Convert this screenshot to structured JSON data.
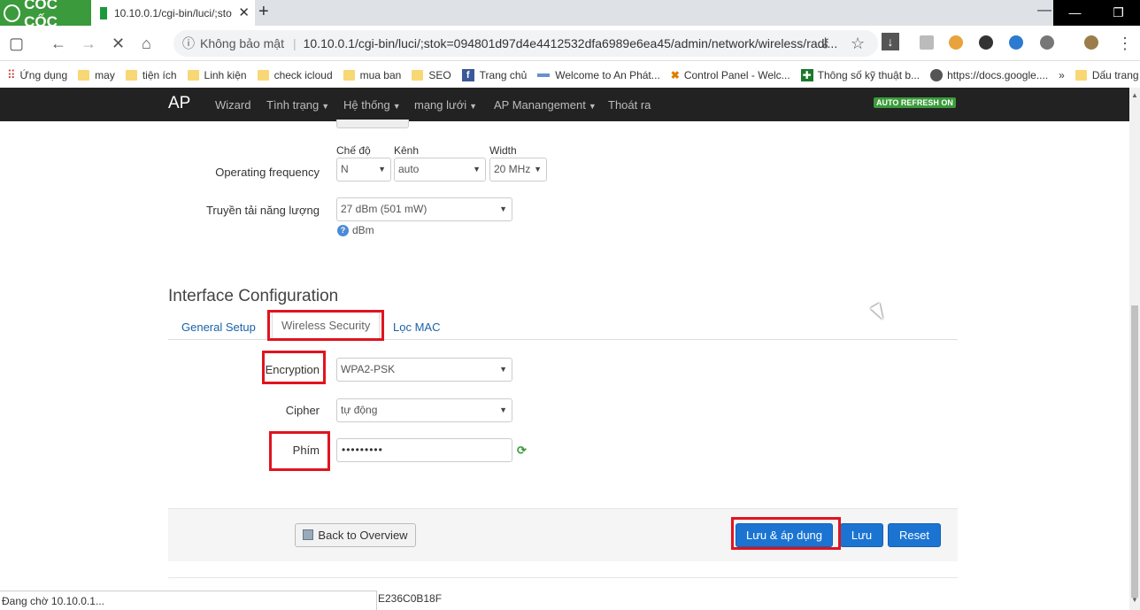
{
  "browser": {
    "brand": "CỐC CỐC",
    "tab_title": "10.10.0.1/cgi-bin/luci/;sto",
    "tab_close": "✕",
    "new_tab": "+",
    "omnibox": {
      "security_label": "Không bảo mật",
      "url": "10.10.0.1/cgi-bin/luci/;stok=094801d97d4e4412532dfa6989e6ea45/admin/network/wireless/radi..."
    },
    "bookmarks": [
      "Ứng dụng",
      "may",
      "tiện ích",
      "Linh kiện",
      "check icloud",
      "mua ban",
      "SEO",
      "Trang chủ",
      "Welcome to An Phát...",
      "Control Panel - Welc...",
      "Thông số kỹ thuật b...",
      "https://docs.google....",
      "Dấu trang khác"
    ],
    "bookmarks_more": "»",
    "status_text": "Đang chờ 10.10.0.1..."
  },
  "appnav": {
    "brand": "AP",
    "menu": [
      "Wizard",
      "Tình trạng",
      "Hệ thống",
      "mạng lưới",
      "AP Manangement",
      "Thoát ra"
    ],
    "auto_refresh": "AUTO REFRESH ON"
  },
  "device": {
    "operating_frequency_label": "Operating frequency",
    "mode_label": "Chế độ",
    "mode_value": "N",
    "channel_label": "Kênh",
    "channel_value": "auto",
    "width_label": "Width",
    "width_value": "20 MHz",
    "tx_power_label": "Truyền tải năng lượng",
    "tx_power_value": "27 dBm (501 mW)",
    "tx_power_hint": "dBm"
  },
  "interface": {
    "title": "Interface Configuration",
    "tabs": [
      "General Setup",
      "Wireless Security",
      "Lọc MAC"
    ],
    "encryption_label": "Encryption",
    "encryption_value": "WPA2-PSK",
    "cipher_label": "Cipher",
    "cipher_value": "tự động",
    "key_label": "Phím",
    "key_value": "•••••••••"
  },
  "footer": {
    "back": "Back to Overview",
    "save_apply": "Lưu & áp dụng",
    "save": "Lưu",
    "reset": "Reset"
  },
  "serial_fragment": "E236C0B18F",
  "colors": {
    "highlight": "#e0141e",
    "primary": "#1b74d2",
    "navbar": "#222222",
    "badge": "#3a9b3a"
  }
}
